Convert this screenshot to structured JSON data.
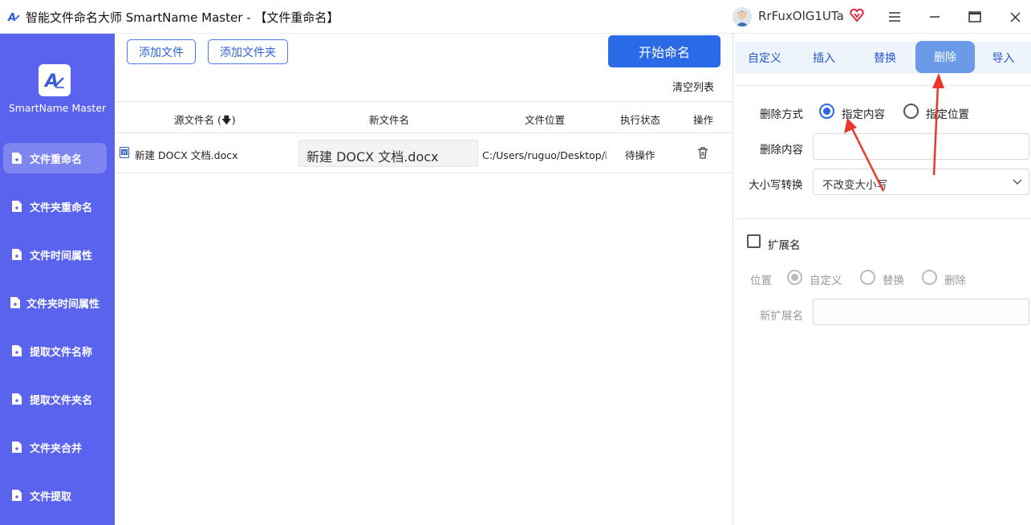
{
  "window": {
    "title": "智能文件命名大师 SmartName Master - 【文件重命名】",
    "username": "RrFuxOlG1UTa"
  },
  "sidebar": {
    "brand": "SmartName Master",
    "items": [
      {
        "label": "文件重命名",
        "active": true
      },
      {
        "label": "文件夹重命名",
        "active": false
      },
      {
        "label": "文件时间属性",
        "active": false
      },
      {
        "label": "文件夹时间属性",
        "active": false
      },
      {
        "label": "提取文件名称",
        "active": false
      },
      {
        "label": "提取文件夹名",
        "active": false
      },
      {
        "label": "文件夹合并",
        "active": false
      },
      {
        "label": "文件提取",
        "active": false
      }
    ]
  },
  "toolbar": {
    "add_file": "添加文件",
    "add_folder": "添加文件夹",
    "start": "开始命名",
    "clear_list": "清空列表"
  },
  "table": {
    "columns": [
      "源文件名 (🡇)",
      "新文件名",
      "文件位置",
      "执行状态",
      "操作"
    ],
    "rows": [
      {
        "source": "新建 DOCX 文档.docx",
        "new_name": "新建 DOCX 文档.docx",
        "location": "C:/Users/ruguo/Desktop/新",
        "status": "待操作"
      }
    ]
  },
  "panel": {
    "tabs": [
      {
        "label": "自定义",
        "active": false
      },
      {
        "label": "插入",
        "active": false
      },
      {
        "label": "替换",
        "active": false
      },
      {
        "label": "删除",
        "active": true
      },
      {
        "label": "导入",
        "active": false
      }
    ],
    "delete_mode_label": "删除方式",
    "delete_mode_options": [
      "指定内容",
      "指定位置"
    ],
    "delete_mode_selected": "指定内容",
    "delete_content_label": "删除内容",
    "delete_content_value": "",
    "case_label": "大小写转换",
    "case_value": "不改变大小写",
    "extension_label": "扩展名",
    "extension_checked": false,
    "position_label": "位置",
    "position_options": [
      "自定义",
      "替换",
      "删除"
    ],
    "position_selected": "自定义",
    "new_ext_label": "新扩展名",
    "new_ext_value": ""
  },
  "colors": {
    "sidebar": "#5a63ee",
    "accent": "#2a6ae6",
    "active_tab": "#6b9be8",
    "annotation_arrow": "#e8382c"
  }
}
